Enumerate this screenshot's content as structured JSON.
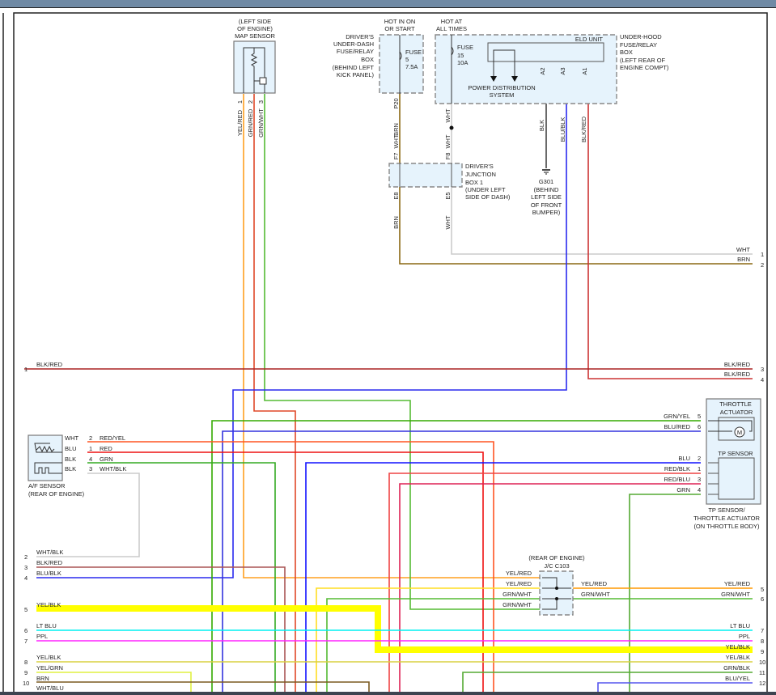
{
  "colors": {
    "frame_bar": "#6f8aa5",
    "YEL/RED": "#ffa020",
    "GRN/RED": "#e04828",
    "GRN/WHT": "#55bb33",
    "BRN": "#8b6914",
    "WHT": "#cccccc",
    "BLK": "#444444",
    "BLU/BLK": "#2a2aee",
    "BLK/RED": "#cc3333",
    "GRN/YEL": "#33aa00",
    "BLU/RED": "#3333dd",
    "RED/YEL": "#ff5522",
    "RED": "#ee1111",
    "GRN": "#33aa22",
    "BLU": "#1111ff",
    "RED/BLK": "#ee4444",
    "RED/BLU": "#dd2255",
    "YEL/BLK_thick": "#ffff00",
    "LT BLU": "#00f0f0",
    "PPL": "#ff22ff",
    "YEL/BLK": "#d8d040",
    "YEL/GRN": "#e0f040",
    "GRN/BLK": "#55aa33",
    "BLU/YEL": "#5555ee"
  },
  "map_sensor": {
    "loc1": "(LEFT SIDE",
    "loc2": "OF ENGINE)",
    "name": "MAP SENSOR",
    "pins": [
      "1",
      "2",
      "3"
    ],
    "wires": [
      "YEL/RED",
      "GRN/RED",
      "GRN/WHT"
    ]
  },
  "dash_fuse_box": {
    "hot": [
      "HOT IN ON",
      "OR START"
    ],
    "label": [
      "DRIVER'S",
      "UNDER-DASH",
      "FUSE/RELAY",
      "BOX",
      "(BEHIND LEFT",
      "KICK PANEL)"
    ],
    "fuse": [
      "FUSE",
      "5",
      "7.5A"
    ],
    "pin": "P20",
    "wire": "BRN"
  },
  "hood_box": {
    "hot": [
      "HOT AT",
      "ALL TIMES"
    ],
    "fuse": [
      "FUSE",
      "15",
      "10A"
    ],
    "eld": "ELD UNIT",
    "pds": [
      "POWER DISTRIBUTION",
      "SYSTEM"
    ],
    "label": [
      "UNDER-HOOD",
      "FUSE/RELAY",
      "BOX",
      "(LEFT REAR OF",
      "ENGINE COMPT)"
    ],
    "pins": [
      "A2",
      "A3",
      "A1"
    ],
    "wires": [
      "BLK",
      "BLU/BLK",
      "BLK/RED"
    ],
    "wht_upper": "WHT"
  },
  "junction_box": {
    "label": [
      "DRIVER'S",
      "JUNCTION",
      "BOX 1",
      "(UNDER LEFT",
      "SIDE OF DASH)"
    ],
    "pins": [
      "F7",
      "F8",
      "E8",
      "E5"
    ],
    "wires": [
      "BRN",
      "WHT",
      "BRN",
      "WHT"
    ]
  },
  "ground": {
    "label": [
      "G301",
      "(BEHIND",
      "LEFT SIDE",
      "OF FRONT",
      "BUMPER)"
    ]
  },
  "throttle": {
    "title": [
      "THROTTLE",
      "ACTUATOR"
    ],
    "motor": "M",
    "tp": "TP SENSOR",
    "caption": [
      "TP SENSOR/",
      "THROTTLE ACTUATOR",
      "(ON THROTTLE BODY)"
    ],
    "wires": [
      {
        "label": "GRN/YEL",
        "pin": "5"
      },
      {
        "label": "BLU/RED",
        "pin": "6"
      },
      {
        "label": "BLU",
        "pin": "2"
      },
      {
        "label": "RED/BLK",
        "pin": "1"
      },
      {
        "label": "RED/BLU",
        "pin": "3"
      },
      {
        "label": "GRN",
        "pin": "4"
      }
    ]
  },
  "af_sensor": {
    "name": "A/F SENSOR",
    "loc": "(REAR OF ENGINE)",
    "inner": [
      "WHT",
      "BLU",
      "BLK",
      "BLK"
    ],
    "pins": [
      "2",
      "1",
      "4",
      "3"
    ],
    "wires": [
      "RED/YEL",
      "RED",
      "GRN",
      "WHT/BLK"
    ]
  },
  "jc": {
    "loc": "(REAR OF ENGINE)",
    "name": "J/C C103",
    "left": [
      "YEL/RED",
      "YEL/RED",
      "GRN/WHT",
      "GRN/WHT"
    ],
    "right": [
      "YEL/RED",
      "GRN/WHT"
    ]
  },
  "left_conn": [
    {
      "pin": "1",
      "label": "BLK/RED"
    },
    {
      "pin": "2",
      "label": "WHT/BLK"
    },
    {
      "pin": "3",
      "label": "BLK/RED"
    },
    {
      "pin": "4",
      "label": "BLU/BLK"
    },
    {
      "pin": "5",
      "label": "YEL/BLK"
    },
    {
      "pin": "6",
      "label": "LT BLU"
    },
    {
      "pin": "7",
      "label": "PPL"
    },
    {
      "pin": "8",
      "label": "YEL/BLK"
    },
    {
      "pin": "9",
      "label": "YEL/GRN"
    },
    {
      "pin": "10",
      "label": "BRN"
    },
    {
      "pin": "",
      "label": "WHT/BLU"
    }
  ],
  "right_conn": [
    {
      "pin": "1",
      "label": "WHT"
    },
    {
      "pin": "2",
      "label": "BRN"
    },
    {
      "pin": "3",
      "label": "BLK/RED"
    },
    {
      "pin": "4",
      "label": "BLK/RED"
    },
    {
      "pin": "5",
      "label": "YEL/RED"
    },
    {
      "pin": "6",
      "label": "GRN/WHT"
    },
    {
      "pin": "7",
      "label": "LT BLU"
    },
    {
      "pin": "8",
      "label": "PPL"
    },
    {
      "pin": "9",
      "label": "YEL/BLK"
    },
    {
      "pin": "10",
      "label": "YEL/BLK"
    },
    {
      "pin": "11",
      "label": "GRN/BLK"
    },
    {
      "pin": "12",
      "label": "BLU/YEL"
    }
  ]
}
